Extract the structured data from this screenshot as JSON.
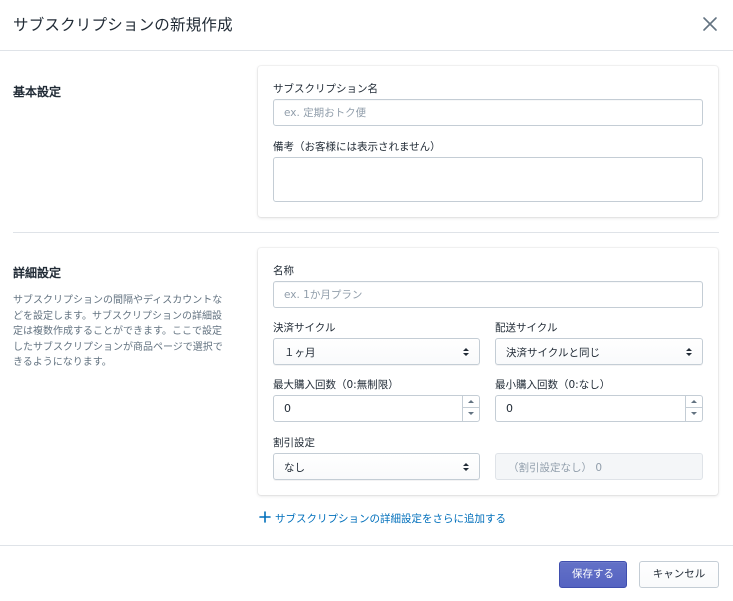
{
  "header": {
    "title": "サブスクリプションの新規作成"
  },
  "basic": {
    "section_title": "基本設定",
    "name_label": "サブスクリプション名",
    "name_placeholder": "ex. 定期おトク便",
    "note_label": "備考（お客様には表示されません）",
    "note_value": ""
  },
  "detail": {
    "section_title": "詳細設定",
    "description": "サブスクリプションの間隔やディスカウントなどを設定します。サブスクリプションの詳細設定は複数作成することができます。ここで設定したサブスクリプションが商品ページで選択できるようになります。",
    "name_label": "名称",
    "name_placeholder": "ex. 1か月プラン",
    "payment_cycle_label": "決済サイクル",
    "payment_cycle_value": "１ヶ月",
    "delivery_cycle_label": "配送サイクル",
    "delivery_cycle_value": "決済サイクルと同じ",
    "max_purchase_label": "最大購入回数（0:無制限）",
    "max_purchase_value": "0",
    "min_purchase_label": "最小購入回数（0:なし）",
    "min_purchase_value": "0",
    "discount_label": "割引設定",
    "discount_value": "なし",
    "discount_amount_value": "（割引設定なし） 0"
  },
  "add_link": {
    "label": "サブスクリプションの詳細設定をさらに追加する"
  },
  "footer": {
    "save_label": "保存する",
    "cancel_label": "キャンセル"
  },
  "colors": {
    "primary": "#5c6ac4",
    "link": "#006fbb",
    "border": "#c4cdd5"
  },
  "icons": {
    "close": "close-icon",
    "select_arrows": "select-arrows-icon",
    "plus": "plus-icon"
  }
}
